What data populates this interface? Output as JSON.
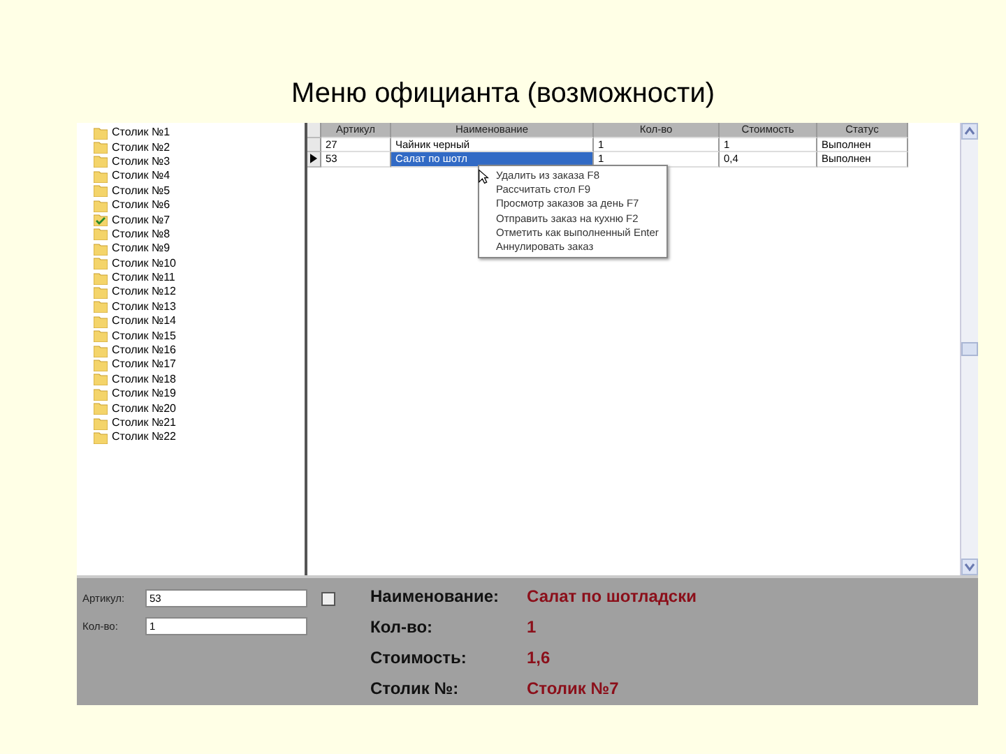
{
  "slide_title": "Меню официанта (возможности)",
  "tables": [
    {
      "label": "Столик №1",
      "selected": false
    },
    {
      "label": "Столик №2",
      "selected": false
    },
    {
      "label": "Столик №3",
      "selected": false
    },
    {
      "label": "Столик №4",
      "selected": false
    },
    {
      "label": "Столик №5",
      "selected": false
    },
    {
      "label": "Столик №6",
      "selected": false
    },
    {
      "label": "Столик №7",
      "selected": true
    },
    {
      "label": "Столик №8",
      "selected": false
    },
    {
      "label": "Столик №9",
      "selected": false
    },
    {
      "label": "Столик №10",
      "selected": false
    },
    {
      "label": "Столик №11",
      "selected": false
    },
    {
      "label": "Столик №12",
      "selected": false
    },
    {
      "label": "Столик №13",
      "selected": false
    },
    {
      "label": "Столик №14",
      "selected": false
    },
    {
      "label": "Столик №15",
      "selected": false
    },
    {
      "label": "Столик №16",
      "selected": false
    },
    {
      "label": "Столик №17",
      "selected": false
    },
    {
      "label": "Столик №18",
      "selected": false
    },
    {
      "label": "Столик №19",
      "selected": false
    },
    {
      "label": "Столик №20",
      "selected": false
    },
    {
      "label": "Столик №21",
      "selected": false
    },
    {
      "label": "Столик №22",
      "selected": false
    }
  ],
  "grid": {
    "columns": [
      "Артикул",
      "Наименование",
      "Кол-во",
      "Стоимость",
      "Статус"
    ],
    "rows": [
      {
        "cells": [
          "27",
          "Чайник черный",
          "1",
          "1",
          "Выполнен"
        ],
        "selected": false
      },
      {
        "cells": [
          "53",
          "Салат по шотл",
          "1",
          "0,4",
          "Выполнен"
        ],
        "selected": true
      }
    ]
  },
  "context_menu": [
    "Удалить из заказа F8",
    "Рассчитать стол F9",
    "Просмотр заказов за день F7",
    "Отправить заказ на кухню F2",
    "Отметить как выполненный Enter",
    "Аннулировать заказ"
  ],
  "form": {
    "fields": [
      {
        "label": "Артикул:",
        "value": "53"
      },
      {
        "label": "Кол-во:",
        "value": "1"
      }
    ],
    "details": [
      {
        "label": "Наименование:",
        "value": "Салат по шотладски"
      },
      {
        "label": "Кол-во:",
        "value": "1"
      },
      {
        "label": "Стоимость:",
        "value": "1,6"
      },
      {
        "label": "Столик №:",
        "value": "Столик №7"
      }
    ]
  }
}
